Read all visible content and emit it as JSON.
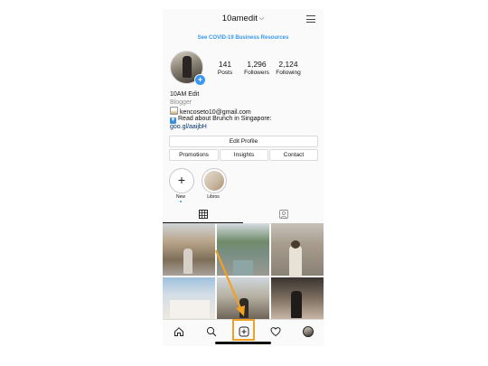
{
  "header": {
    "username": "10amedit",
    "chevron": "⌵",
    "menu_icon": "hamburger-menu-icon"
  },
  "banner": {
    "text": "See COVID-19 Business Resources"
  },
  "stats": [
    {
      "value": "141",
      "label": "Posts"
    },
    {
      "value": "1,296",
      "label": "Followers"
    },
    {
      "value": "2,124",
      "label": "Following"
    }
  ],
  "bio": {
    "name": "10AM Edit",
    "category": "Blogger",
    "email": "kencoseto10@gmail.com",
    "read_line": "Read about Brunch in Singapore:",
    "link": "goo.gl/aaijbH"
  },
  "buttons": {
    "edit_profile": "Edit Profile",
    "promotions": "Promotions",
    "insights": "Insights",
    "contact": "Contact"
  },
  "highlights": [
    {
      "label": "New",
      "icon": "plus-icon"
    },
    {
      "label": "Libros",
      "icon": "highlight-cover"
    }
  ],
  "colors": {
    "accent_blue": "#3897f0",
    "highlight_orange": "#f0a125",
    "link_navy": "#003569"
  },
  "nav": [
    "home-icon",
    "search-icon",
    "new-post-icon",
    "heart-icon",
    "profile-avatar"
  ]
}
